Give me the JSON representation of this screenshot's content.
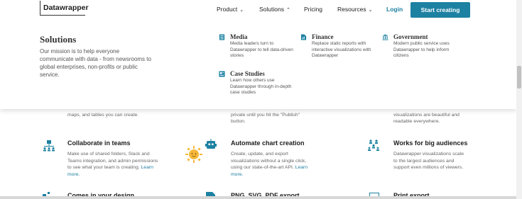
{
  "nav": {
    "logo": "Datawrapper",
    "items": [
      {
        "label": "Product",
        "chevron": "⌄"
      },
      {
        "label": "Solutions",
        "chevron": "⌃"
      },
      {
        "label": "Pricing",
        "chevron": ""
      },
      {
        "label": "Resources",
        "chevron": "⌄"
      }
    ],
    "login": "Login",
    "cta": "Start creating"
  },
  "dropdown": {
    "title": "Solutions",
    "description": "Our mission is to help everyone communicate with data - from newsrooms to global enterprises, non-profits or public service.",
    "items": [
      {
        "title": "Media",
        "desc": "Media leaders turn to Datawrapper to tell data-driven stories",
        "icon": "newspaper-icon"
      },
      {
        "title": "Finance",
        "desc": "Replace static reports with interactive visualizations with Datawrapper",
        "icon": "report-icon"
      },
      {
        "title": "Government",
        "desc": "Modern public service uses Datawrapper to help inform citizens",
        "icon": "government-icon"
      },
      {
        "title": "Case Studies",
        "desc": "Learn how others use Datawrapper through in-depth case studies",
        "icon": "case-study-icon"
      }
    ]
  },
  "content": {
    "partial_1": "maps, and tables you can create.",
    "partial_2a": "private until you hit the \"Publish\"",
    "partial_2b": "button.",
    "partial_3a": "visualizations are beautiful and",
    "partial_3b": "readable everywhere.",
    "features": [
      {
        "title": "Collaborate in teams",
        "desc": "Make use of shared folders, Slack and Teams integration, and admin permissions to see what your team is creating.",
        "link": "Learn more."
      },
      {
        "title": "Automate chart creation",
        "desc": "Create, update, and export visualizations without a single click, using our state-of-the-art API.",
        "link": "Learn more."
      },
      {
        "title": "Works for big audiences",
        "desc": "Datawrapper visualizations scale to the largest audiences and support even millions of viewers.",
        "link": ""
      }
    ],
    "bottom_features": [
      "Comes in your design",
      "PNG, SVG, PDF export",
      "Print export"
    ]
  },
  "colors": {
    "accent": "#1d81a2"
  }
}
